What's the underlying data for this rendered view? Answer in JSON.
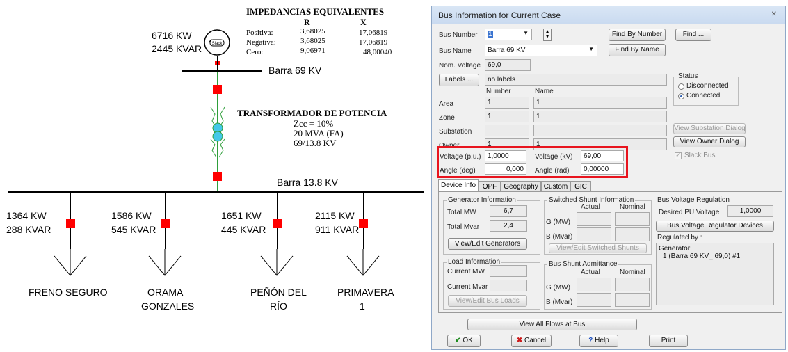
{
  "diagram": {
    "impedance_title": "IMPEDANCIAS EQUIVALENTES",
    "col_r": "R",
    "col_x": "X",
    "rows": [
      {
        "label": "Positiva:",
        "r": "3,68025",
        "x": "17,06819"
      },
      {
        "label": "Negativa:",
        "r": "3,68025",
        "x": "17,06819"
      },
      {
        "label": "Cero:",
        "r": "9,06971",
        "x": "48,00040"
      }
    ],
    "gen_kw": "6716 KW",
    "gen_kvar": "2445 KVAR",
    "gen_symbol": "Slack",
    "bus69_label": "Barra 69 KV",
    "transformer_title": "TRANSFORMADOR DE POTENCIA",
    "transformer_lines": [
      "Zcc = 10%",
      "20 MVA (FA)",
      "69/13.8 KV"
    ],
    "bus138_label": "Barra 13.8 KV",
    "loads": [
      {
        "kw": "1364 KW",
        "kvar": "288  KVAR",
        "name1": "FRENO SEGURO",
        "name2": ""
      },
      {
        "kw": "1586 KW",
        "kvar": "545  KVAR",
        "name1": "ORAMA",
        "name2": "GONZALES"
      },
      {
        "kw": "1651 KW",
        "kvar": "445  KVAR",
        "name1": "PEÑÓN DEL",
        "name2": "RÍO"
      },
      {
        "kw": "2115 KW",
        "kvar": "911 KVAR",
        "name1": "PRIMAVERA",
        "name2": "1"
      }
    ]
  },
  "dialog": {
    "title": "Bus Information for Current Case",
    "close_glyph": "✕",
    "bus_number_label": "Bus Number",
    "bus_number_value": "1",
    "find_by_number": "Find By Number",
    "find": "Find ...",
    "bus_name_label": "Bus Name",
    "bus_name_value": "Barra 69 KV",
    "find_by_name": "Find By Name",
    "nom_voltage_label": "Nom. Voltage",
    "nom_voltage_value": "69,0",
    "labels_button": "Labels ...",
    "labels_value": "no labels",
    "col_number": "Number",
    "col_name": "Name",
    "area_label": "Area",
    "area_number": "1",
    "area_name": "1",
    "zone_label": "Zone",
    "zone_number": "1",
    "zone_name": "1",
    "substation_label": "Substation",
    "substation_number": "",
    "substation_name": "",
    "owner_label": "Owner",
    "owner_number": "1",
    "owner_name": "1",
    "status_title": "Status",
    "status_disconnected": "Disconnected",
    "status_connected": "Connected",
    "view_substation": "View Substation Dialog",
    "view_owner": "View Owner Dialog",
    "slack_bus": "Slack Bus",
    "voltage_pu_label": "Voltage (p.u.)",
    "voltage_pu_value": "1,0000",
    "voltage_kv_label": "Voltage (kV)",
    "voltage_kv_value": "69,00",
    "angle_deg_label": "Angle (deg)",
    "angle_deg_value": "0,000",
    "angle_rad_label": "Angle (rad)",
    "angle_rad_value": "0,00000",
    "tabs": [
      "Device Info",
      "OPF",
      "Geography",
      "Custom",
      "GIC"
    ],
    "gen_info_title": "Generator Information",
    "total_mw_label": "Total MW",
    "total_mw_value": "6,7",
    "total_mvar_label": "Total Mvar",
    "total_mvar_value": "2,4",
    "view_edit_generators": "View/Edit Generators",
    "load_info_title": "Load Information",
    "current_mw_label": "Current MW",
    "current_mvar_label": "Current Mvar",
    "view_edit_loads": "View/Edit Bus Loads",
    "switched_shunt_title": "Switched Shunt Information",
    "actual": "Actual",
    "nominal": "Nominal",
    "g_mw": "G (MW)",
    "b_mvar": "B (Mvar)",
    "view_edit_shunts": "View/Edit Switched Shunts",
    "bus_shunt_title": "Bus Shunt Admittance",
    "bvr_title": "Bus Voltage Regulation",
    "desired_pu_label": "Desired PU Voltage",
    "desired_pu_value": "1,0000",
    "bvr_devices": "Bus Voltage Regulator Devices",
    "regulated_by": "Regulated by :",
    "regulated_text1": "Generator:",
    "regulated_text2": "1 (Barra 69 KV_ 69,0) #1",
    "view_all_flows": "View All Flows at Bus",
    "ok": "OK",
    "cancel": "Cancel",
    "help": "Help",
    "print": "Print",
    "highlight_color": "#e8141e"
  }
}
